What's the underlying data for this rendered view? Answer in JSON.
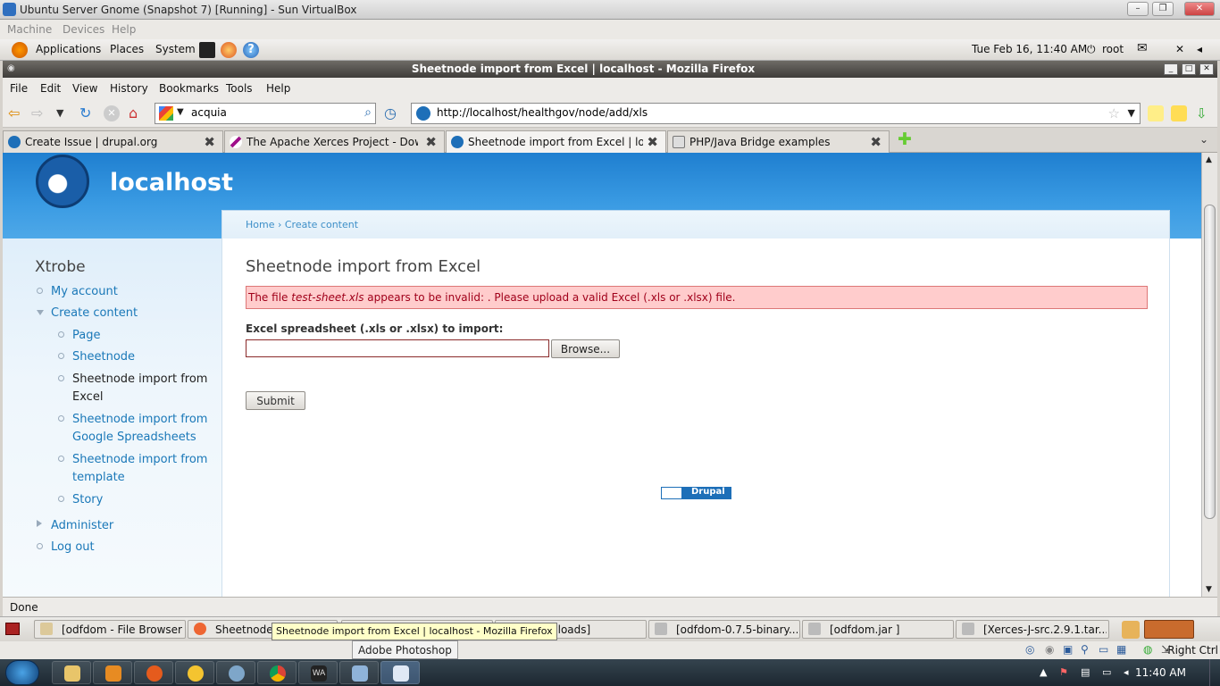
{
  "host_window": {
    "title": "Ubuntu Server Gnome (Snapshot 7) [Running] - Sun VirtualBox",
    "menu": [
      "Machine",
      "Devices",
      "Help"
    ]
  },
  "gnome_panel": {
    "menus": [
      "Applications",
      "Places",
      "System"
    ],
    "clock": "Tue Feb 16, 11:40 AM",
    "user": "root"
  },
  "browser": {
    "window_title": "Sheetnode import from Excel | localhost - Mozilla Firefox",
    "menu": [
      "File",
      "Edit",
      "View",
      "History",
      "Bookmarks",
      "Tools",
      "Help"
    ],
    "search_value": "acquia",
    "url": "http://localhost/healthgov/node/add/xls",
    "tabs": [
      {
        "label": "Create Issue | drupal.org",
        "active": false
      },
      {
        "label": "The Apache Xerces Project - Dow...",
        "active": false
      },
      {
        "label": "Sheetnode import from Excel | loc...",
        "active": true
      },
      {
        "label": "PHP/Java Bridge examples",
        "active": false
      }
    ],
    "status": "Done"
  },
  "page": {
    "site_name": "localhost",
    "breadcrumb": "Home › Create content",
    "sidebar": {
      "title": "Xtrobe",
      "items": [
        {
          "label": "My account",
          "level": 1
        },
        {
          "label": "Create content",
          "level": 1
        },
        {
          "label": "Page",
          "level": 2
        },
        {
          "label": "Sheetnode",
          "level": 2
        },
        {
          "label": "Sheetnode import from Excel",
          "level": 2
        },
        {
          "label": "Sheetnode import from Google Spreadsheets",
          "level": 2
        },
        {
          "label": "Sheetnode import from template",
          "level": 2
        },
        {
          "label": "Story",
          "level": 2
        },
        {
          "label": "Administer",
          "level": 1
        },
        {
          "label": "Log out",
          "level": 1
        }
      ]
    },
    "title": "Sheetnode import from Excel",
    "error": {
      "prefix": "The file ",
      "filename": "test-sheet.xls",
      "suffix": " appears to be invalid: . Please upload a valid Excel (.xls or .xlsx) file."
    },
    "file_label": "Excel spreadsheet (.xls or .xlsx) to import:",
    "browse_label": "Browse...",
    "submit_label": "Submit",
    "powered_by": "Drupal"
  },
  "gnome_taskbar": {
    "tasks": [
      "[odfdom - File Browser]",
      "Sheetnode",
      "",
      "nloads]",
      "[odfdom-0.7.5-binary....",
      "[odfdom.jar ]",
      "[Xerces-J-src.2.9.1.tar...."
    ],
    "tooltip_firefox": "Sheetnode import from Excel | localhost - Mozilla Firefox",
    "tooltip_photoshop": "Adobe Photoshop"
  },
  "vbox_status": {
    "host_key": "Right Ctrl"
  },
  "windows_taskbar": {
    "clock": "11:40 AM"
  }
}
